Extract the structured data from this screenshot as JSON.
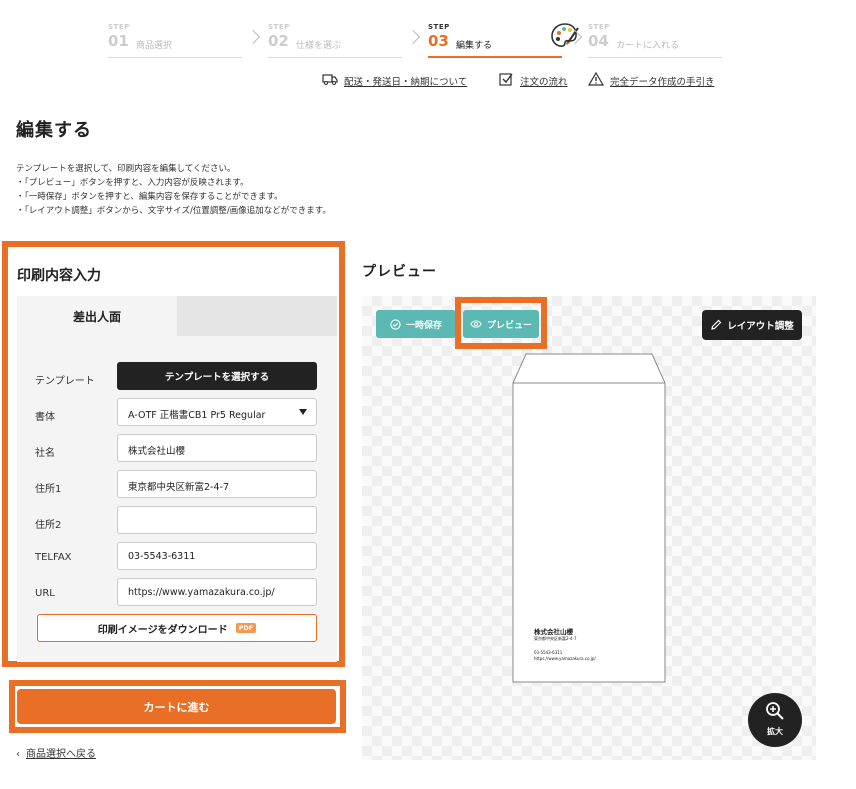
{
  "steps": [
    {
      "tag": "STEP",
      "num": "01",
      "label": "商品選択"
    },
    {
      "tag": "STEP",
      "num": "02",
      "label": "仕様を選ぶ"
    },
    {
      "tag": "STEP",
      "num": "03",
      "label": "編集する"
    },
    {
      "tag": "STEP",
      "num": "04",
      "label": "カートに入れる"
    }
  ],
  "links": {
    "shipping": "配送・発送日・納期について",
    "flow": "注文の流れ",
    "guide": "完全データ作成の手引き"
  },
  "page_title": "編集する",
  "description": [
    "テンプレートを選択して、印刷内容を編集してください。",
    "・「プレビュー」ボタンを押すと、入力内容が反映されます。",
    "・「一時保存」ボタンを押すと、編集内容を保存することができます。",
    "・「レイアウト調整」ボタンから、文字サイズ/位置調整/画像追加などができます。"
  ],
  "form": {
    "title": "印刷内容入力",
    "tab_active": "差出人面",
    "template_label": "テンプレート",
    "template_button": "テンプレートを選択する",
    "font_label": "書体",
    "font_value": "A-OTF 正楷書CB1 Pr5 Regular",
    "company_label": "社名",
    "company_value": "株式会社山櫻",
    "address1_label": "住所1",
    "address1_value": "東京都中央区新富2-4-7",
    "address2_label": "住所2",
    "address2_value": "",
    "telfax_label": "TELFAX",
    "telfax_value": "03-5543-6311",
    "url_label": "URL",
    "url_value": "https://www.yamazakura.co.jp/",
    "download_button": "印刷イメージをダウンロード",
    "pdf_badge": "PDF"
  },
  "cart_button": "カートに進む",
  "back_link": "商品選択へ戻る",
  "preview": {
    "title": "プレビュー",
    "save_button": "一時保存",
    "preview_button": "プレビュー",
    "layout_button": "レイアウト調整",
    "zoom_label": "拡大",
    "env_company": "株式会社山櫻",
    "env_address": "東京都中央区新富2-4-7",
    "env_tel": "03-5543-6311",
    "env_url": "https://www.yamazakura.co.jp/"
  },
  "colors": {
    "accent": "#e86f25",
    "teal": "#5bb8b2",
    "dark": "#222222"
  }
}
